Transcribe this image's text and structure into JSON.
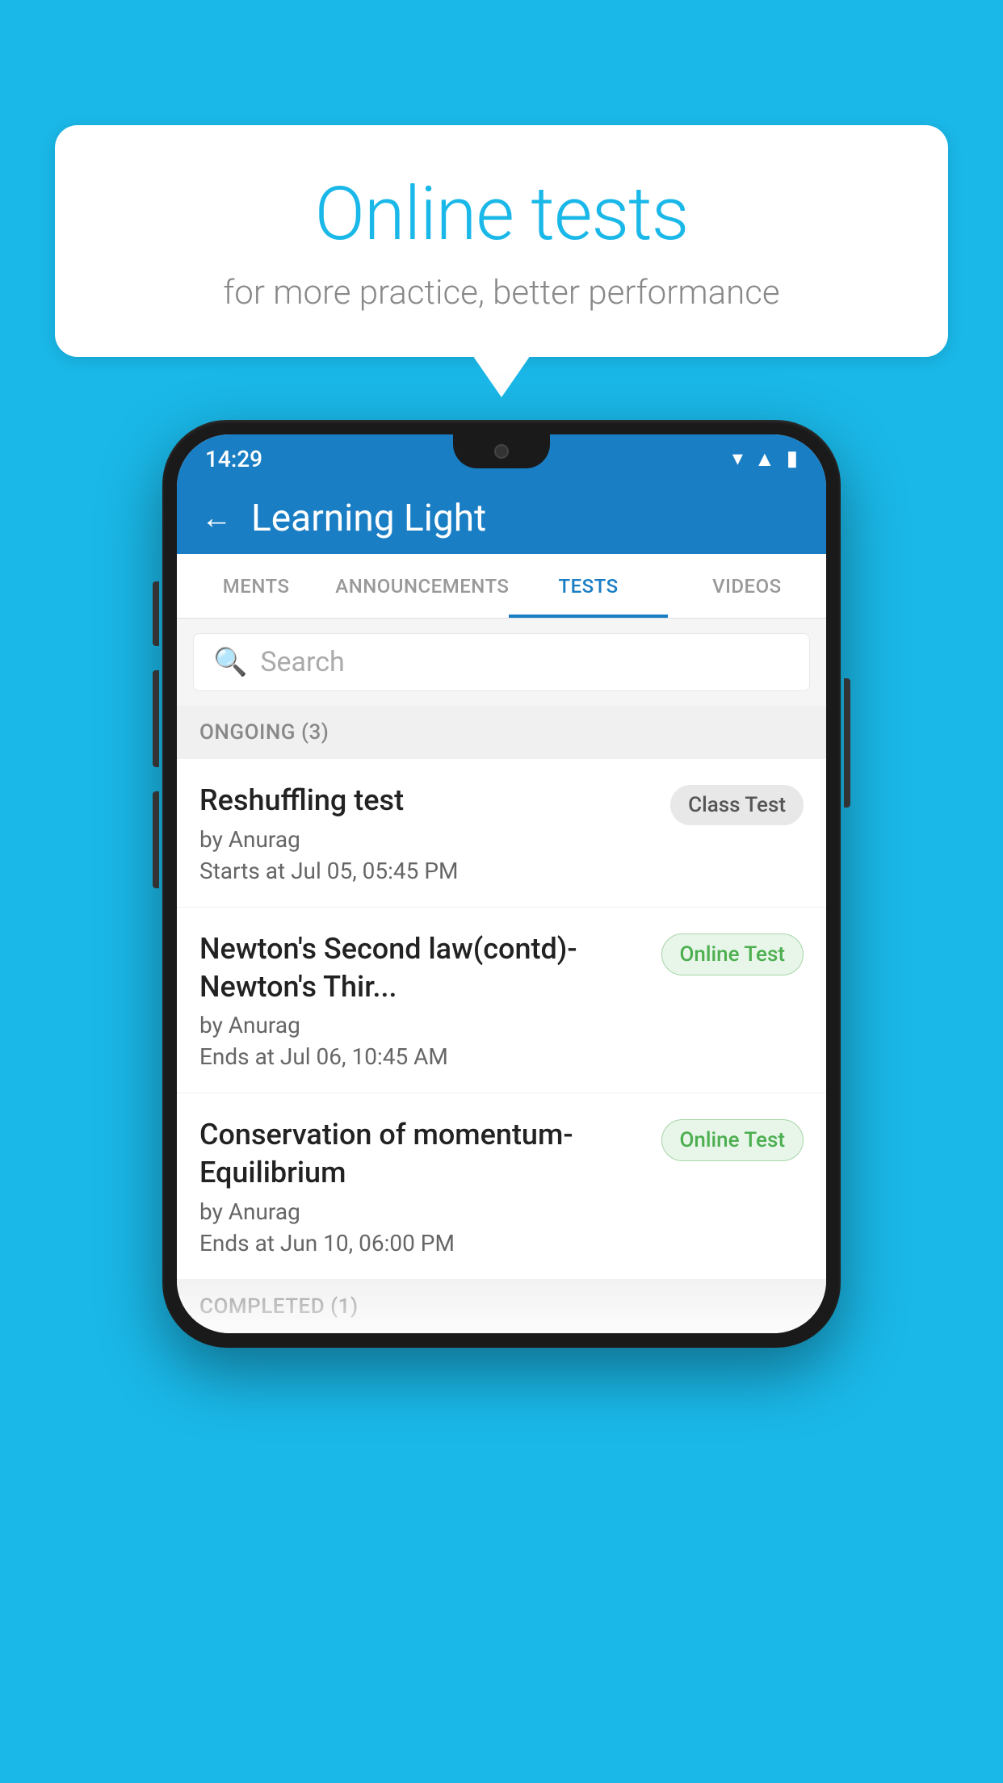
{
  "background": {
    "color": "#1ab8e8"
  },
  "bubble": {
    "title": "Online tests",
    "subtitle": "for more practice, better performance"
  },
  "phone": {
    "status_bar": {
      "time": "14:29",
      "icons": [
        "wifi",
        "signal",
        "battery"
      ]
    },
    "app_bar": {
      "back_label": "←",
      "title": "Learning Light"
    },
    "tabs": [
      {
        "label": "MENTS",
        "active": false
      },
      {
        "label": "ANNOUNCEMENTS",
        "active": false
      },
      {
        "label": "TESTS",
        "active": true
      },
      {
        "label": "VIDEOS",
        "active": false
      }
    ],
    "search": {
      "placeholder": "Search"
    },
    "section_ongoing": {
      "label": "ONGOING (3)"
    },
    "tests": [
      {
        "title": "Reshuffling test",
        "by": "by Anurag",
        "date": "Starts at  Jul 05, 05:45 PM",
        "badge": "Class Test",
        "badge_type": "class"
      },
      {
        "title": "Newton's Second law(contd)-Newton's Thir...",
        "by": "by Anurag",
        "date": "Ends at  Jul 06, 10:45 AM",
        "badge": "Online Test",
        "badge_type": "online"
      },
      {
        "title": "Conservation of momentum-Equilibrium",
        "by": "by Anurag",
        "date": "Ends at  Jun 10, 06:00 PM",
        "badge": "Online Test",
        "badge_type": "online"
      }
    ],
    "section_completed": {
      "label": "COMPLETED (1)"
    }
  }
}
